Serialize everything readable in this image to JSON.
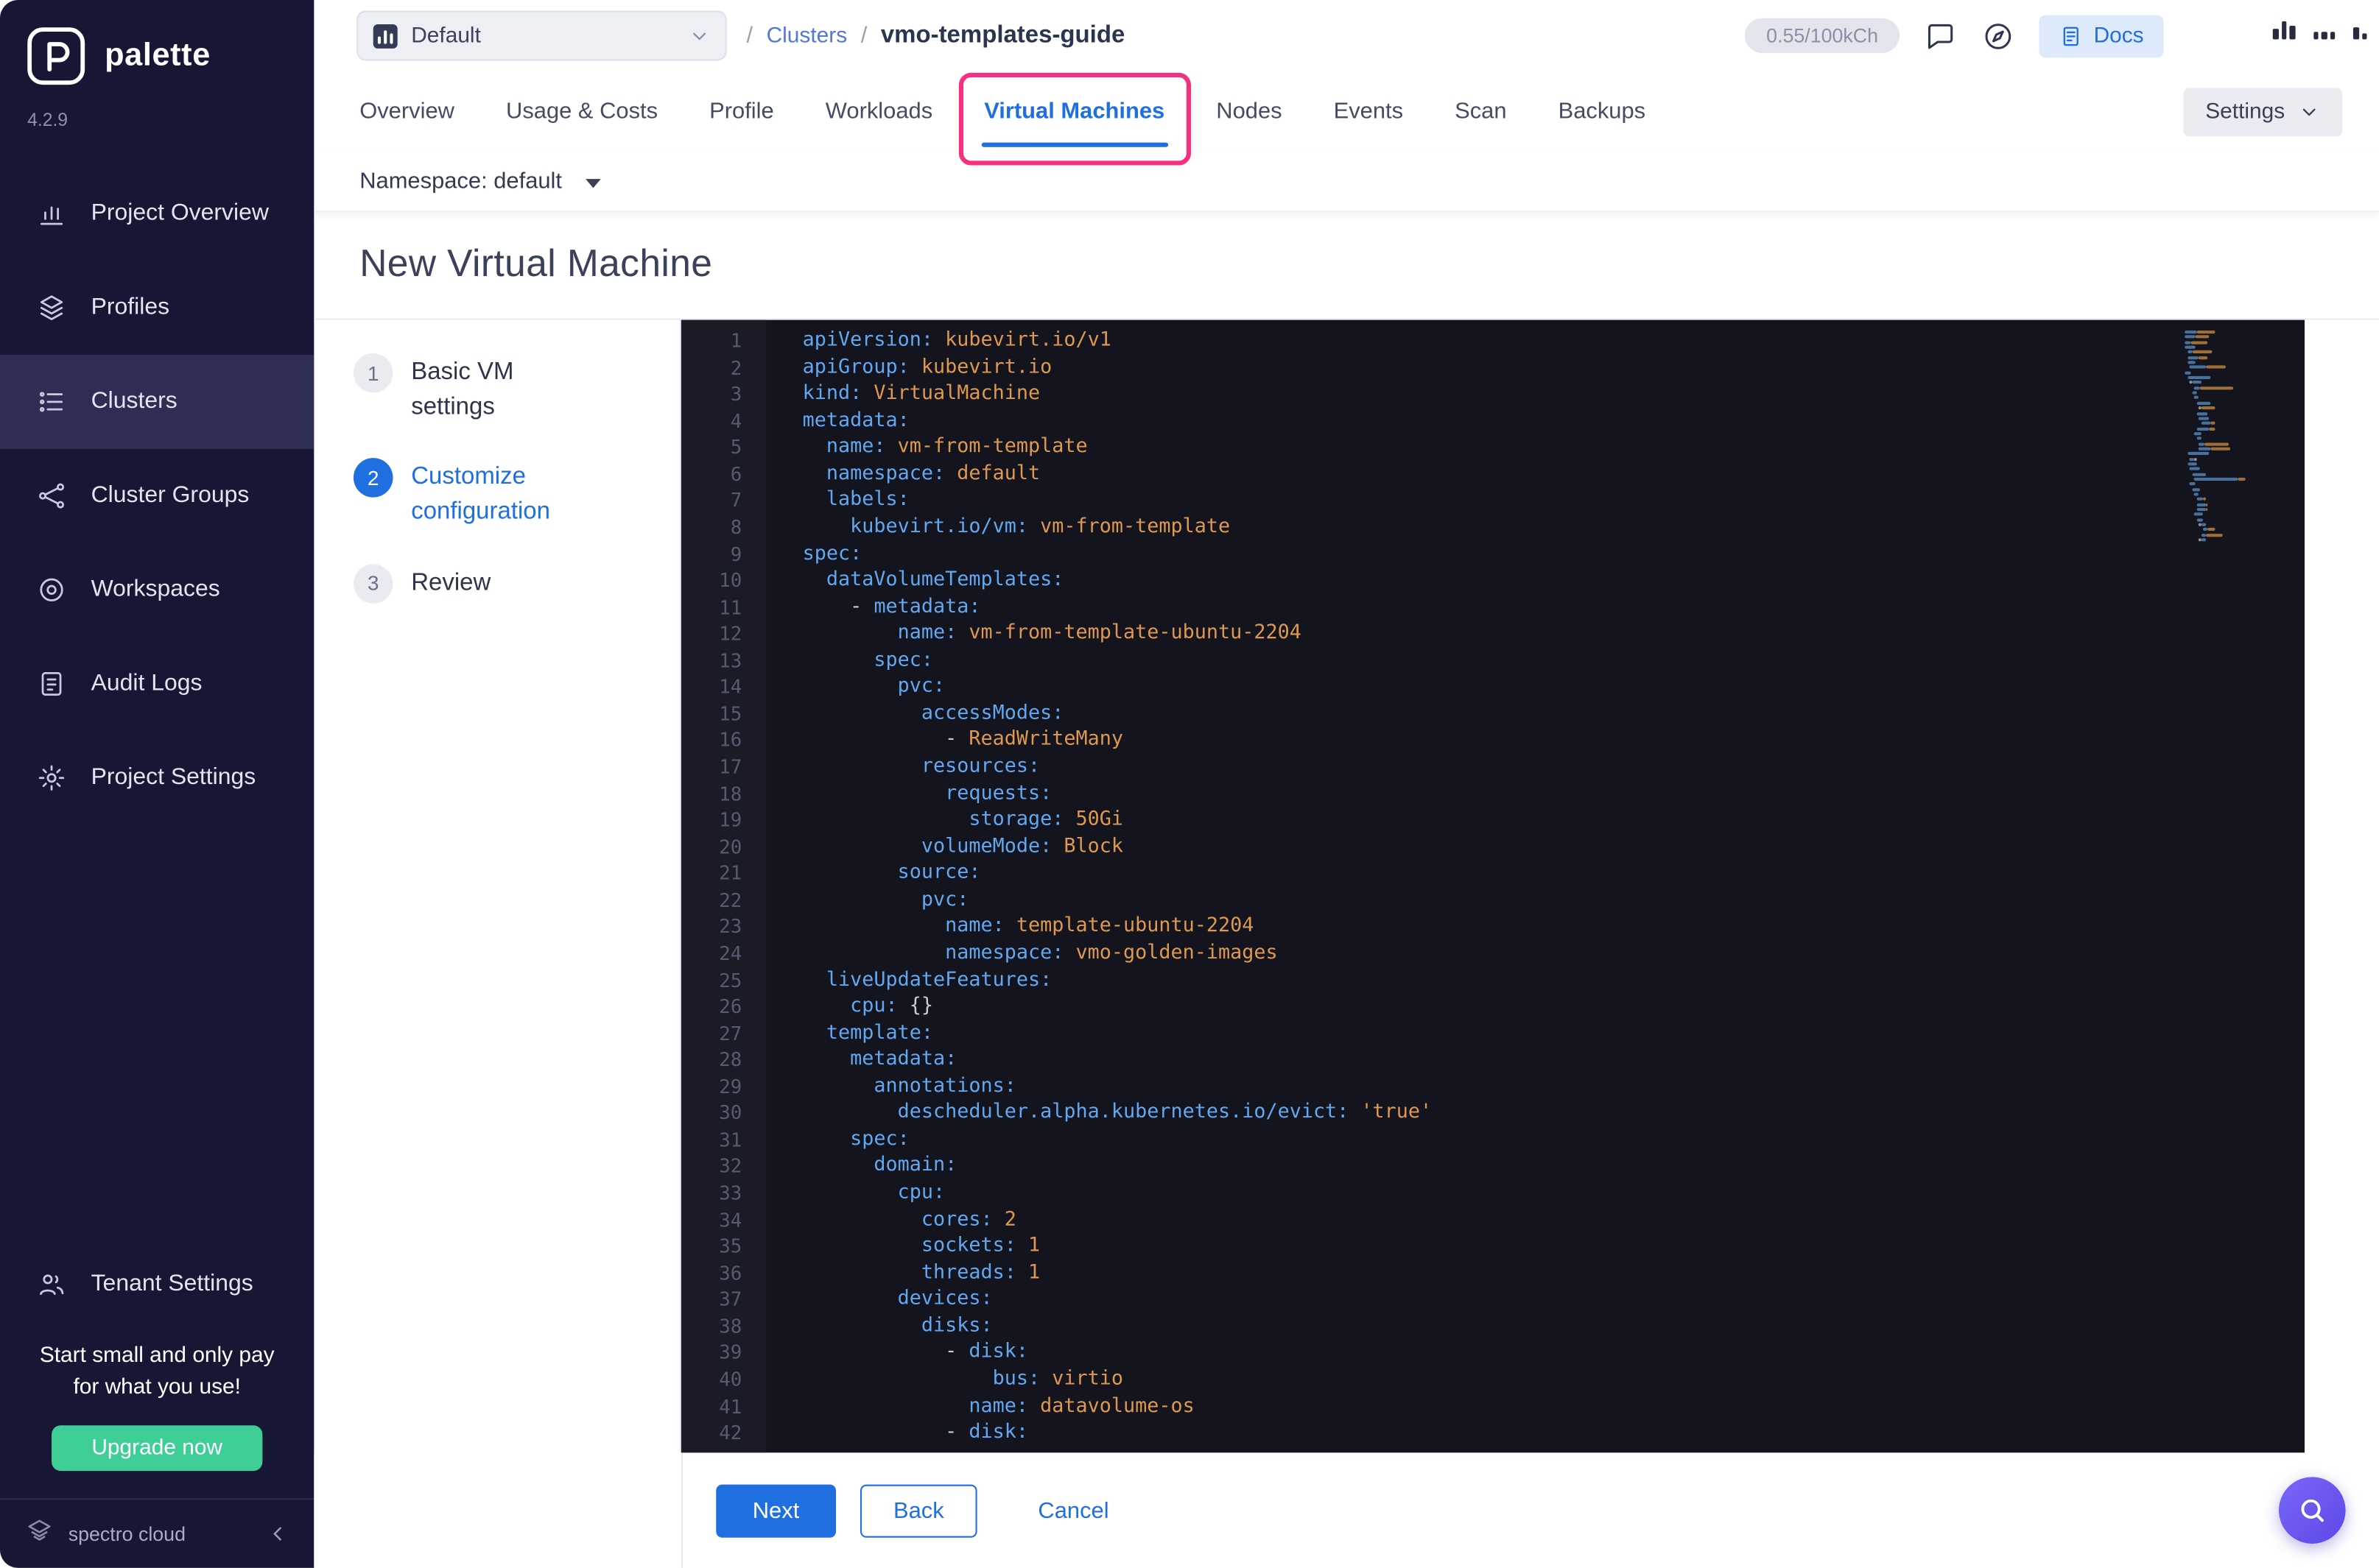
{
  "colors": {
    "accent": "#1F6FE0",
    "highlight": "#F5317F",
    "upgrade_green": "#3FCF96",
    "editor_key": "#62A8F0",
    "editor_value": "#DE9850"
  },
  "sidebar": {
    "brand": "palette",
    "version": "4.2.9",
    "items": [
      {
        "label": "Project Overview",
        "icon": "chart",
        "active": false
      },
      {
        "label": "Profiles",
        "icon": "layers",
        "active": false
      },
      {
        "label": "Clusters",
        "icon": "list",
        "active": true
      },
      {
        "label": "Cluster Groups",
        "icon": "network",
        "active": false
      },
      {
        "label": "Workspaces",
        "icon": "target",
        "active": false
      },
      {
        "label": "Audit Logs",
        "icon": "document",
        "active": false
      },
      {
        "label": "Project Settings",
        "icon": "gear",
        "active": false
      }
    ],
    "tenant_item": {
      "label": "Tenant Settings",
      "icon": "people"
    },
    "promo": {
      "line1": "Start small and only pay",
      "line2": "for what you use!"
    },
    "upgrade_button": "Upgrade now",
    "footer_brand": "spectro cloud"
  },
  "header": {
    "project_selector": {
      "value": "Default"
    },
    "breadcrumb": {
      "sep": "/",
      "parent": "Clusters",
      "current": "vmo-templates-guide"
    },
    "usage_pill": "0.55/100kCh",
    "docs_button": "Docs"
  },
  "tabs": {
    "items": [
      "Overview",
      "Usage & Costs",
      "Profile",
      "Workloads",
      "Virtual Machines",
      "Nodes",
      "Events",
      "Scan",
      "Backups"
    ],
    "active": "Virtual Machines",
    "settings_button": "Settings"
  },
  "namespace_bar": {
    "label": "Namespace: default"
  },
  "page": {
    "title": "New Virtual Machine"
  },
  "stepper": {
    "steps": [
      {
        "num": "1",
        "label": "Basic VM settings",
        "state": "default"
      },
      {
        "num": "2",
        "label": "Customize configuration",
        "state": "active"
      },
      {
        "num": "3",
        "label": "Review",
        "state": "default"
      }
    ]
  },
  "editor": {
    "lines": [
      {
        "n": "1",
        "s": [
          [
            "apiVersion:",
            "k"
          ],
          [
            " kubevirt.io/v1",
            "v"
          ]
        ]
      },
      {
        "n": "2",
        "s": [
          [
            "apiGroup:",
            "k"
          ],
          [
            " kubevirt.io",
            "v"
          ]
        ]
      },
      {
        "n": "3",
        "s": [
          [
            "kind:",
            "k"
          ],
          [
            " VirtualMachine",
            "v"
          ]
        ]
      },
      {
        "n": "4",
        "s": [
          [
            "metadata:",
            "k"
          ]
        ]
      },
      {
        "n": "5",
        "s": [
          [
            "  name:",
            "k"
          ],
          [
            " vm-from-template",
            "v"
          ]
        ]
      },
      {
        "n": "6",
        "s": [
          [
            "  namespace:",
            "k"
          ],
          [
            " default",
            "v"
          ]
        ]
      },
      {
        "n": "7",
        "s": [
          [
            "  labels:",
            "k"
          ]
        ]
      },
      {
        "n": "8",
        "s": [
          [
            "    kubevirt.io/vm:",
            "k"
          ],
          [
            " vm-from-template",
            "v"
          ]
        ]
      },
      {
        "n": "9",
        "s": [
          [
            "spec:",
            "k"
          ]
        ]
      },
      {
        "n": "10",
        "s": [
          [
            "  dataVolumeTemplates:",
            "k"
          ]
        ]
      },
      {
        "n": "11",
        "s": [
          [
            "    - ",
            "p"
          ],
          [
            "metadata:",
            "k"
          ]
        ]
      },
      {
        "n": "12",
        "s": [
          [
            "        name:",
            "k"
          ],
          [
            " vm-from-template-ubuntu-2204",
            "v"
          ]
        ]
      },
      {
        "n": "13",
        "s": [
          [
            "      spec:",
            "k"
          ]
        ]
      },
      {
        "n": "14",
        "s": [
          [
            "        pvc:",
            "k"
          ]
        ]
      },
      {
        "n": "15",
        "s": [
          [
            "          accessModes:",
            "k"
          ]
        ]
      },
      {
        "n": "16",
        "s": [
          [
            "            - ",
            "p"
          ],
          [
            "ReadWriteMany",
            "v"
          ]
        ]
      },
      {
        "n": "17",
        "s": [
          [
            "          resources:",
            "k"
          ]
        ]
      },
      {
        "n": "18",
        "s": [
          [
            "            requests:",
            "k"
          ]
        ]
      },
      {
        "n": "19",
        "s": [
          [
            "              storage:",
            "k"
          ],
          [
            " 50Gi",
            "v"
          ]
        ]
      },
      {
        "n": "20",
        "s": [
          [
            "          volumeMode:",
            "k"
          ],
          [
            " Block",
            "v"
          ]
        ]
      },
      {
        "n": "21",
        "s": [
          [
            "        source:",
            "k"
          ]
        ]
      },
      {
        "n": "22",
        "s": [
          [
            "          pvc:",
            "k"
          ]
        ]
      },
      {
        "n": "23",
        "s": [
          [
            "            name:",
            "k"
          ],
          [
            " template-ubuntu-2204",
            "v"
          ]
        ]
      },
      {
        "n": "24",
        "s": [
          [
            "            namespace:",
            "k"
          ],
          [
            " vmo-golden-images",
            "v"
          ]
        ]
      },
      {
        "n": "25",
        "s": [
          [
            "  liveUpdateFeatures:",
            "k"
          ]
        ]
      },
      {
        "n": "26",
        "s": [
          [
            "    cpu:",
            "k"
          ],
          [
            " {}",
            "p"
          ]
        ]
      },
      {
        "n": "27",
        "s": [
          [
            "  template:",
            "k"
          ]
        ]
      },
      {
        "n": "28",
        "s": [
          [
            "    metadata:",
            "k"
          ]
        ]
      },
      {
        "n": "29",
        "s": [
          [
            "      annotations:",
            "k"
          ]
        ]
      },
      {
        "n": "30",
        "s": [
          [
            "        descheduler.alpha.kubernetes.io/evict:",
            "k"
          ],
          [
            " 'true'",
            "v"
          ]
        ]
      },
      {
        "n": "31",
        "s": [
          [
            "    spec:",
            "k"
          ]
        ]
      },
      {
        "n": "32",
        "s": [
          [
            "      domain:",
            "k"
          ]
        ]
      },
      {
        "n": "33",
        "s": [
          [
            "        cpu:",
            "k"
          ]
        ]
      },
      {
        "n": "34",
        "s": [
          [
            "          cores:",
            "k"
          ],
          [
            " 2",
            "v"
          ]
        ]
      },
      {
        "n": "35",
        "s": [
          [
            "          sockets:",
            "k"
          ],
          [
            " 1",
            "v"
          ]
        ]
      },
      {
        "n": "36",
        "s": [
          [
            "          threads:",
            "k"
          ],
          [
            " 1",
            "v"
          ]
        ]
      },
      {
        "n": "37",
        "s": [
          [
            "        devices:",
            "k"
          ]
        ]
      },
      {
        "n": "38",
        "s": [
          [
            "          disks:",
            "k"
          ]
        ]
      },
      {
        "n": "39",
        "s": [
          [
            "            - ",
            "p"
          ],
          [
            "disk:",
            "k"
          ]
        ]
      },
      {
        "n": "40",
        "s": [
          [
            "                bus:",
            "k"
          ],
          [
            " virtio",
            "v"
          ]
        ]
      },
      {
        "n": "41",
        "s": [
          [
            "              name:",
            "k"
          ],
          [
            " datavolume-os",
            "v"
          ]
        ]
      },
      {
        "n": "42",
        "s": [
          [
            "            - ",
            "p"
          ],
          [
            "disk:",
            "k"
          ]
        ]
      }
    ]
  },
  "footer": {
    "next": "Next",
    "back": "Back",
    "cancel": "Cancel"
  }
}
